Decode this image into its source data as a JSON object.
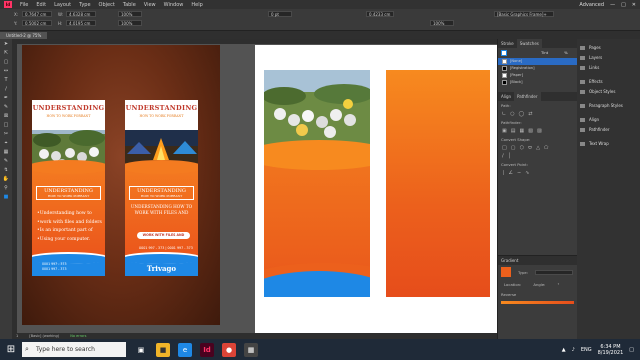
{
  "app": {
    "logo": "Id"
  },
  "menu": {
    "items": [
      "File",
      "Edit",
      "Layout",
      "Type",
      "Object",
      "Table",
      "View",
      "Window",
      "Help"
    ],
    "workspace": "Advanced"
  },
  "control": {
    "x": "0.7647 cm",
    "y": "0.5002 cm",
    "w": "4.6328 cm",
    "h": "4.0195 cm",
    "scale_x": "100%",
    "scale_y": "100%",
    "stroke": "0 pt",
    "size": "0.4233 cm",
    "zoom": "100%",
    "frame_style": "[Basic Graphics Frame]+"
  },
  "tab": {
    "title": "Untitled-2 @ 75%"
  },
  "brochure1": {
    "title": "UNDERSTANDING",
    "subtitle": "HOW TO WORK PORRANT",
    "heading": "UNDERSTANDING",
    "heading_sub": "HOW TO WORK PORRANT",
    "bullets": [
      "Understanding how to",
      "work with files and folders",
      "Is an important part of",
      "Using your computer."
    ],
    "phone1": "0001 997 - 373",
    "phone2": "0001 997 - 373"
  },
  "brochure2": {
    "title": "UNDERSTANDING",
    "subtitle": "HOW TO WORK PORRANT",
    "heading": "UNDERSTANDING",
    "heading_sub": "HOW TO WORK PORRANT",
    "body": "UNDERSTANDING HOW TO WORK WITH FILES AND",
    "button": "WORK WITH FILES AND",
    "phone": "0001 997 - 373 | 0001 997 - 373",
    "brand": "Trivago"
  },
  "panels": {
    "swatches_tab": "Swatches",
    "stroke_tab": "Stroke",
    "tint_label": "Tint",
    "tint_value": "%",
    "swatches": [
      "[None]",
      "[Registration]",
      "[Paper]",
      "[Black]"
    ],
    "align_tab": "Align",
    "pathfinder_tab": "Pathfinder",
    "path_label": "Path:",
    "pathfinder_label": "Pathfinder:",
    "convert_shape_label": "Convert Shape:",
    "convert_point_label": "Convert Point:",
    "gradient_tab": "Gradient",
    "type_label": "Type:",
    "location_label": "Location:",
    "angle_label": "Angle:",
    "angle_value": "°",
    "reverse_label": "Reverse"
  },
  "dock": {
    "items": [
      "Pages",
      "Layers",
      "Links",
      "Effects",
      "Object Styles",
      "Paragraph Styles",
      "Align",
      "Pathfinder",
      "Text Wrap"
    ]
  },
  "status": {
    "page": "1",
    "style": "[Basic] (working)",
    "errors": "No errors"
  },
  "taskbar": {
    "search_placeholder": "Type here to search",
    "lang": "ENG",
    "time": "6:34 PM",
    "date": "8/19/2021"
  },
  "colors": {
    "accent_orange": "#f47b20",
    "accent_blue": "#1e88e5",
    "title_red": "#c0392b"
  }
}
